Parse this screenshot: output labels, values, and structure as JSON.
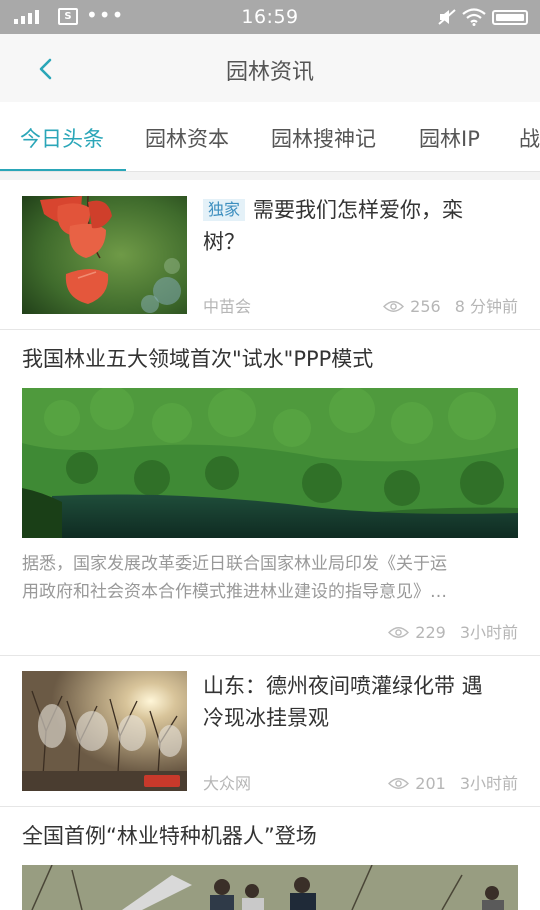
{
  "status_bar": {
    "time": "16:59",
    "sim_label": "S",
    "dots": "•••"
  },
  "header": {
    "title": "园林资讯",
    "back_icon": "chevron-left-icon"
  },
  "tabs": [
    {
      "label": "今日头条",
      "active": true
    },
    {
      "label": "园林资本",
      "active": false
    },
    {
      "label": "园林搜神记",
      "active": false
    },
    {
      "label": "园林IP",
      "active": false
    },
    {
      "label": "战",
      "active": false
    }
  ],
  "articles": [
    {
      "badge": "独家",
      "title_line1": "需要我们怎样爱你，栾",
      "title_line2": "树？",
      "source": "中苗会",
      "views": "256",
      "time": "8 分钟前"
    },
    {
      "title": "我国林业五大领域首次\"试水\"PPP模式",
      "summary_line1": "据悉，国家发展改革委近日联合国家林业局印发《关于运",
      "summary_line2": "用政府和社会资本合作模式推进林业建设的指导意见》…",
      "views": "229",
      "time": "3小时前"
    },
    {
      "title_line1": "山东：德州夜间喷灌绿化带 遇",
      "title_line2": "冷现冰挂景观",
      "source": "大众网",
      "views": "201",
      "time": "3小时前"
    },
    {
      "title": "全国首例“林业特种机器人”登场"
    }
  ],
  "colors": {
    "accent": "#2aa6b8",
    "status_bar": "#a9a9a9",
    "header_bg": "#f7f7f7",
    "badge_bg": "#e4f1f8",
    "badge_text": "#3e8fbf",
    "meta_text": "#b6b6b6"
  }
}
